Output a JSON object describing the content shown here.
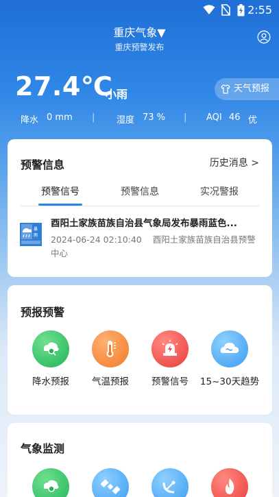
{
  "status_bar": {
    "time": "2:55"
  },
  "header": {
    "city": "重庆气象▼",
    "source": "重庆预警发布"
  },
  "current": {
    "temperature": "27.4℃",
    "weather": "小雨",
    "forecast_button": "天气预报",
    "stats": {
      "precip_label": "降水",
      "precip_value": "0 mm",
      "humidity_label": "湿度",
      "humidity_value": "73 %",
      "aqi_label": "AQI",
      "aqi_value": "46",
      "aqi_level": "优"
    }
  },
  "warning": {
    "title": "预警信息",
    "history": "历史消息 >",
    "tabs": [
      "预警信号",
      "预警信息",
      "实况警报"
    ],
    "alert": {
      "badge_top": "暴雨",
      "title": "酉阳土家族苗族自治县气象局发布暴雨蓝色...",
      "date": "2024-06-24 02:10:40",
      "issuer": "酉阳土家族苗族自治县预警中心"
    }
  },
  "forecast": {
    "title": "预报预警",
    "items": [
      {
        "label": "降水预报",
        "icon": "rain-magnifier-icon"
      },
      {
        "label": "气温预报",
        "icon": "thermometer-icon"
      },
      {
        "label": "预警信号",
        "icon": "siren-icon"
      },
      {
        "label": "15~30天趋势",
        "icon": "cloud-icon"
      }
    ]
  },
  "monitor": {
    "title": "气象监测"
  },
  "colors": {
    "accent": "#2a82e4",
    "green": "#22b35a",
    "orange": "#f07a2a",
    "red": "#ea3b3b",
    "blue": "#3a9cf0"
  }
}
